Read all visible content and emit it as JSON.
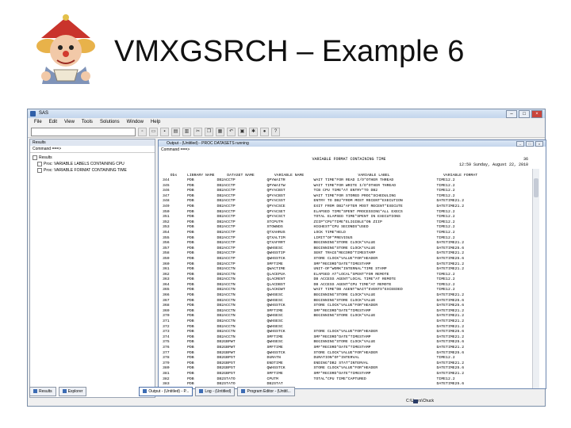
{
  "slide": {
    "title": "VMXGSRCH – Example 6"
  },
  "window": {
    "title": "SAS",
    "menu": [
      "File",
      "Edit",
      "View",
      "Tools",
      "Solutions",
      "Window",
      "Help"
    ]
  },
  "results": {
    "pane_title": "Results",
    "command_label": "Command ===>",
    "root": "Results",
    "items": [
      "Proc: VARIABLE LABELS CONTAINING CPU",
      "Proc: VARIABLE FORMAT CONTAINING TIME"
    ]
  },
  "output": {
    "window_title": "Output - (Untitled) - PROC DATASETS running",
    "command_label": "Command ===>",
    "report_title": "VARIABLE FORMAT CONTAINING TIME",
    "page_number": "36",
    "dateline": "12:59 Sunday, August 22, 2010",
    "headers": [
      "Obs",
      "LIBRARY NAME",
      "DATASET NAME",
      "VARIABLE NAME",
      "VARIABLE LABEL",
      "VARIABLE FORMAT"
    ],
    "rows": [
      [
        "344",
        "PDB",
        "DB2ACCTP",
        "QPYWAITR",
        "WAIT TIME*FOR READ I/O*OTHER THREAD",
        "TIME12.2"
      ],
      [
        "345",
        "PDB",
        "DB2ACCTP",
        "QPYWAITW",
        "WAIT TIME*FOR WRITE I/O*OTHER THREAD",
        "TIME12.2"
      ],
      [
        "346",
        "PDB",
        "DB2ACCTP",
        "QPYACBST",
        "TCB CPU TIME*AT ENTRY*TO DB2",
        "TIME12.2"
      ],
      [
        "347",
        "PDB",
        "DB2ACCTP",
        "QPYACBST",
        "WAIT TIME*FOR STORED PROC*SCHEDULING",
        "TIME12.2"
      ],
      [
        "348",
        "PDB",
        "DB2ACCTP",
        "QPYACSST",
        "ENTRY TO DB2*FROM MOST RECENT*EXECUTION",
        "DATETIME21.2"
      ],
      [
        "349",
        "PDB",
        "DB2ACCTP",
        "QPYACSCE",
        "EXIT FROM DB2*AFTER MOST RECENT*EXECUTE",
        "DATETIME21.2"
      ],
      [
        "350",
        "PDB",
        "DB2ACCTP",
        "QPYACSET",
        "ELAPSED TIME*SPENT PROCESSING*ALL EXECS",
        "TIME12.2"
      ],
      [
        "351",
        "PDB",
        "DB2ACCTP",
        "QPYACSCT",
        "TOTAL ELAPSED TIME*SPENT IN EXECUTIONS",
        "TIME12.2"
      ],
      [
        "352",
        "PDB",
        "DB2ACCTP",
        "STCPUTM",
        "ZIIP*CPU*TIME*ELIGIBLE*ON ZIIP",
        "TIME12.2"
      ],
      [
        "353",
        "PDB",
        "DB2ACCTP",
        "STOWNDS",
        "HIGHEST*CPU SECONDS*USED",
        "TIME12.2"
      ],
      [
        "354",
        "PDB",
        "DB2ACCTP",
        "QTXAHRUS",
        "LOCK TIME*HELD",
        "TIME12.2"
      ],
      [
        "355",
        "PDB",
        "DB2ACCTP",
        "QTXALTIM",
        "LIMIT*OF*PREVIOUS",
        "TIME12.2"
      ],
      [
        "356",
        "PDB",
        "DB2ACCTP",
        "QTXAFRRT",
        "BEGINNING*STORE CLOCK*VALUE",
        "DATETIME21.2"
      ],
      [
        "357",
        "PDB",
        "DB2ACCTP",
        "QWHSESC",
        "BEGINNING*STORE CLOCK*VALUE",
        "DATETIME25.6"
      ],
      [
        "358",
        "PDB",
        "DB2ACCTP",
        "QWHSSTIP",
        "SENT TRACE*RECORD*TIMESTAMP",
        "DATETIME21.2"
      ],
      [
        "359",
        "PDB",
        "DB2ACCTP",
        "QWHSSTCK",
        "STORE CLOCK*VALUE*FOR*HEADER",
        "DATETIME25.6"
      ],
      [
        "360",
        "PDB",
        "DB2ACCTP",
        "SMFTIME",
        "SMF*RECORD*DATE*TIMESTAMP",
        "DATETIME21.2"
      ],
      [
        "361",
        "PDB",
        "DB2ACCTN",
        "QWACTIME",
        "UNIT-OF*WORK*INTERNAL*TIME STAMP",
        "DATETIME21.2"
      ],
      [
        "362",
        "PDB",
        "DB2ACCTN",
        "QLACEPUA",
        "ELAPSED AT*LOCAL*SPENT*FOR REMOTE",
        "TIME12.2"
      ],
      [
        "363",
        "PDB",
        "DB2ACCTN",
        "QLACRENT",
        "DB ACCESS AGENT*LOCAL TIME*AT REMOTE",
        "TIME12.2"
      ],
      [
        "364",
        "PDB",
        "DB2ACCTN",
        "QLACDBST",
        "DB ACCESS AGENT*CPU TIME*AT REMOTE",
        "TIME12.2"
      ],
      [
        "365",
        "PDB",
        "DB2ACCTN",
        "QLACKDWT",
        "WAIT TIME*DB AGENT*WAIT*EVENTS*EXCEEDED",
        "TIME12.2"
      ],
      [
        "366",
        "PDB",
        "DB2ACCTN",
        "QWHSESC",
        "BEGINNING*STORE CLOCK*VALUE",
        "DATETIME21.2"
      ],
      [
        "367",
        "PDB",
        "DB2ACCTN",
        "QWHSESC",
        "BEGINNING*STORE CLOCK*VALUE",
        "DATETIME25.6"
      ],
      [
        "368",
        "PDB",
        "DB2ACCTN",
        "QWHSSTCK",
        "STORE CLOCK*VALUE*FOR*HEADER",
        "DATETIME25.6"
      ],
      [
        "369",
        "PDB",
        "DB2ACCTN",
        "SMFTIME",
        "SMF*RECORD*DATE*TIMESTAMP",
        "DATETIME21.2"
      ],
      [
        "370",
        "PDB",
        "DB2ACCTN",
        "QWHSESC",
        "BEGINNING*STORE CLOCK*VALUE",
        "DATETIME21.2"
      ],
      [
        "371",
        "PDB",
        "DB2ACCTN",
        "QWHSESC",
        "",
        "DATETIME21.2"
      ],
      [
        "372",
        "PDB",
        "DB2ACCTN",
        "QWHSESC",
        "",
        "DATETIME21.2"
      ],
      [
        "373",
        "PDB",
        "DB2ACCTN",
        "QWHSSTCK",
        "STORE CLOCK*VALUE*FOR*HEADER",
        "DATETIME25.6"
      ],
      [
        "374",
        "PDB",
        "DB2ACCTN",
        "SMFTIME",
        "SMF*RECORD*DATE*TIMESTAMP",
        "DATETIME21.2"
      ],
      [
        "375",
        "PDB",
        "DB2GBPWT",
        "QWHSESC",
        "BEGINNING*STORE CLOCK*VALUE",
        "DATETIME25.6"
      ],
      [
        "376",
        "PDB",
        "DB2GBPWT",
        "SMFTIME",
        "SMF*RECORD*DATE*TIMESTAMP",
        "DATETIME21.2"
      ],
      [
        "377",
        "PDB",
        "DB2GBPWT",
        "QWHSSTCK",
        "STORE CLOCK*VALUE*FOR*HEADER",
        "DATETIME25.6"
      ],
      [
        "378",
        "PDB",
        "DB2GBPST",
        "DURATN",
        "DURATION*OF*INTERVAL",
        "TIME12.2"
      ],
      [
        "379",
        "PDB",
        "DB2GBPST",
        "ENDTIME",
        "ENDING*DB2 STAT*INTERVAL",
        "DATETIME21.2"
      ],
      [
        "380",
        "PDB",
        "DB2GBPST",
        "QWHSSTCK",
        "STORE CLOCK*VALUE*FOR*HEADER",
        "DATETIME25.6"
      ],
      [
        "381",
        "PDB",
        "DB2GBPST",
        "SMFTIME",
        "SMF*RECORD*DATE*TIMESTAMP",
        "DATETIME21.2"
      ],
      [
        "382",
        "PDB",
        "DB2STATO",
        "CPUTM",
        "TOTAL*CPU TIME*CAPTURED",
        "TIME12.2"
      ],
      [
        "383",
        "PDB",
        "DB2STATO",
        "DB2STAT",
        "",
        "DATETIME25.6"
      ]
    ]
  },
  "taskbar": {
    "results_tab": "Results",
    "explorer_tab": "Explorer",
    "output_tab": "Output - (Untitled) - P...",
    "log_tab": "Log - (Untitled)",
    "editor_tab": "Program Editor - (Untitl..."
  },
  "status": {
    "path": "C:\\Users\\Chuck"
  }
}
